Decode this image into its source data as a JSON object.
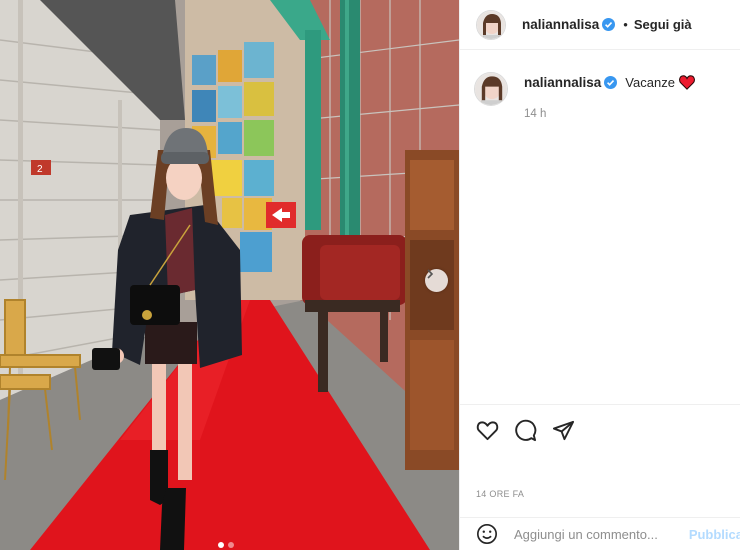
{
  "post": {
    "author": {
      "username": "naliannalisa",
      "verified": true,
      "follow_status": "Segui già",
      "separator": "•"
    },
    "caption": {
      "username": "naliannalisa",
      "text": "Vacanze",
      "emoji": "red-heart",
      "time_ago": "14 h"
    },
    "actions": [
      "like-icon",
      "comment-icon",
      "share-icon"
    ],
    "posted_ago": "14 ORE FA",
    "comment": {
      "placeholder": "Aggiungi un commento...",
      "publish_label": "Pubblica"
    },
    "carousel": {
      "slides": 2,
      "current": 1
    }
  },
  "colors": {
    "accent": "#0095f6",
    "verified": "#3897f0",
    "carpet_red": "#e0141c",
    "heart_red": "#ed1b2f"
  }
}
